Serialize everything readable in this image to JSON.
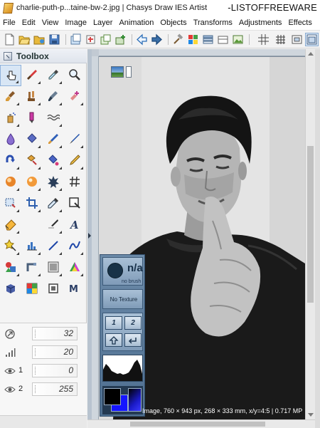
{
  "titlebar": {
    "title": "charlie-puth-p...taine-bw-2.jpg | Chasys Draw IES Artist",
    "watermark": "-LISTOFFREEWARE"
  },
  "menubar": {
    "items": [
      "File",
      "Edit",
      "View",
      "Image",
      "Layer",
      "Animation",
      "Objects",
      "Transforms",
      "Adjustments",
      "Effects"
    ]
  },
  "toolbox": {
    "title": "Toolbox"
  },
  "properties": {
    "size": "32",
    "hardness": "20",
    "opacity_1_label": "1",
    "opacity_1": "0",
    "opacity_2_label": "2",
    "opacity_2": "255"
  },
  "palette": {
    "brush_value": "n/a",
    "brush_caption": "no brush",
    "texture_label": "No Texture",
    "button_1": "1",
    "button_2": "2"
  },
  "status": {
    "text": "Image, 760 × 943 px, 268 × 333 mm, x/y=4:5 | 0.717 MP"
  }
}
